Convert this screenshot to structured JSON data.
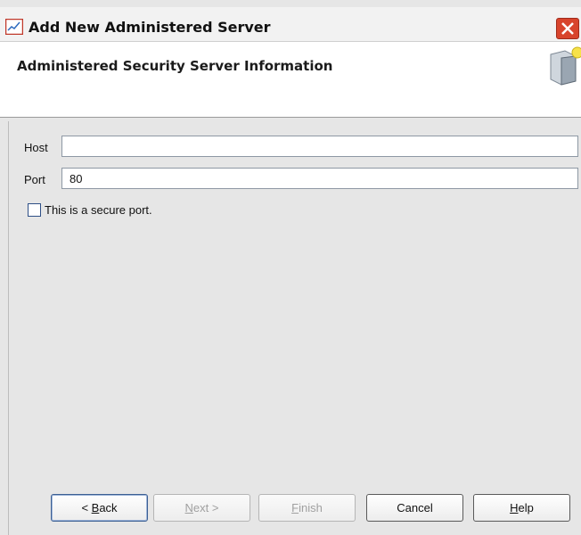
{
  "window": {
    "title": "Add New Administered Server",
    "close_icon": "close-icon",
    "app_icon": "chart-app-icon"
  },
  "header": {
    "title": "Administered Security Server Information",
    "icon": "security-server-icon"
  },
  "form": {
    "host_label": "Host",
    "host_value": "",
    "port_label": "Port",
    "port_value": "80",
    "secure_checkbox_label": "This is a secure port.",
    "secure_checked": false
  },
  "buttons": {
    "back": {
      "pre": "< ",
      "mnemonic": "B",
      "post": "ack",
      "enabled": true
    },
    "next": {
      "pre": "",
      "mnemonic": "N",
      "post": "ext >",
      "enabled": false
    },
    "finish": {
      "pre": "",
      "mnemonic": "F",
      "post": "inish",
      "enabled": false
    },
    "cancel": {
      "label": "Cancel",
      "enabled": true
    },
    "help": {
      "pre": "",
      "mnemonic": "H",
      "post": "elp",
      "enabled": true
    }
  },
  "colors": {
    "close_button": "#d8442c",
    "header_background": "#ffffff",
    "dialog_background": "#e6e6e6"
  }
}
